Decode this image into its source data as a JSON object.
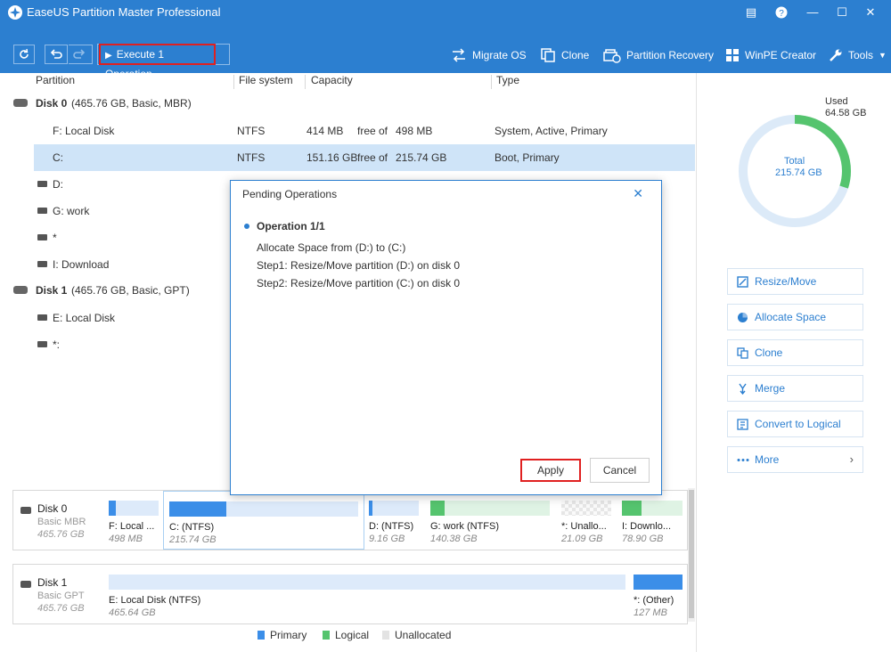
{
  "app": {
    "title": "EaseUS Partition Master Professional"
  },
  "toolbar": {
    "execute_label": "Execute 1 Operation",
    "tools": [
      "Migrate OS",
      "Clone",
      "Partition Recovery",
      "WinPE Creator",
      "Tools"
    ]
  },
  "table": {
    "headers": [
      "Partition",
      "File system",
      "Capacity",
      "Type"
    ],
    "disk0": {
      "label": "Disk 0",
      "info": "(465.76 GB, Basic, MBR)"
    },
    "disk1": {
      "label": "Disk 1",
      "info": "(465.76 GB, Basic, GPT)"
    },
    "rows": [
      {
        "name": "F: Local Disk",
        "fs": "NTFS",
        "used": "414 MB",
        "free_of": "free of",
        "total": "498 MB",
        "type": "System, Active, Primary"
      },
      {
        "name": "C:",
        "fs": "NTFS",
        "used": "151.16 GB",
        "free_of": "free of",
        "total": "215.74 GB",
        "type": "Boot, Primary"
      },
      {
        "name": "D:"
      },
      {
        "name": "G: work"
      },
      {
        "name": "*"
      },
      {
        "name": "I: Download"
      },
      {
        "name": "E: Local Disk"
      },
      {
        "name": "*:"
      }
    ]
  },
  "dialog": {
    "title": "Pending Operations",
    "close": "✕",
    "operation": "Operation 1/1",
    "lines": [
      "Allocate Space from (D:) to (C:)",
      "Step1:   Resize/Move partition (D:) on disk 0",
      "Step2:   Resize/Move partition (C:) on disk 0"
    ],
    "apply": "Apply",
    "cancel": "Cancel"
  },
  "diskmap": {
    "disk0": {
      "name": "Disk 0",
      "type": "Basic MBR",
      "size": "465.76 GB",
      "parts": [
        {
          "name": "F: Local ...",
          "size": "498 MB",
          "fill": 0.14
        },
        {
          "name": "C:  (NTFS)",
          "size": "215.74 GB",
          "fill": 0.3
        },
        {
          "name": "D:  (NTFS)",
          "size": "9.16 GB",
          "fill": 0.08
        },
        {
          "name": "G: work (NTFS)",
          "size": "140.38 GB",
          "fill": 0.12
        },
        {
          "name": "*: Unallo...",
          "size": "21.09 GB"
        },
        {
          "name": "I: Downlo...",
          "size": "78.90 GB",
          "fill": 0.33
        }
      ]
    },
    "disk1": {
      "name": "Disk 1",
      "type": "Basic GPT",
      "size": "465.76 GB",
      "parts": [
        {
          "name": "E: Local Disk (NTFS)",
          "size": "465.64 GB",
          "fill": 0.0
        },
        {
          "name": "*:  (Other)",
          "size": "127 MB",
          "fill": 1.0
        }
      ]
    }
  },
  "legend": [
    "Primary",
    "Logical",
    "Unallocated"
  ],
  "usage": {
    "used_label": "Used",
    "used_value": "64.58 GB",
    "total_label": "Total",
    "total_value": "215.74 GB",
    "used_fraction": 0.3
  },
  "actions": [
    "Resize/Move",
    "Allocate Space",
    "Clone",
    "Merge",
    "Convert to Logical",
    "More"
  ],
  "colors": {
    "accent": "#2c7fd0",
    "highlight": "#e02020",
    "primary": "#3b8ee8",
    "logical": "#55c46e"
  }
}
